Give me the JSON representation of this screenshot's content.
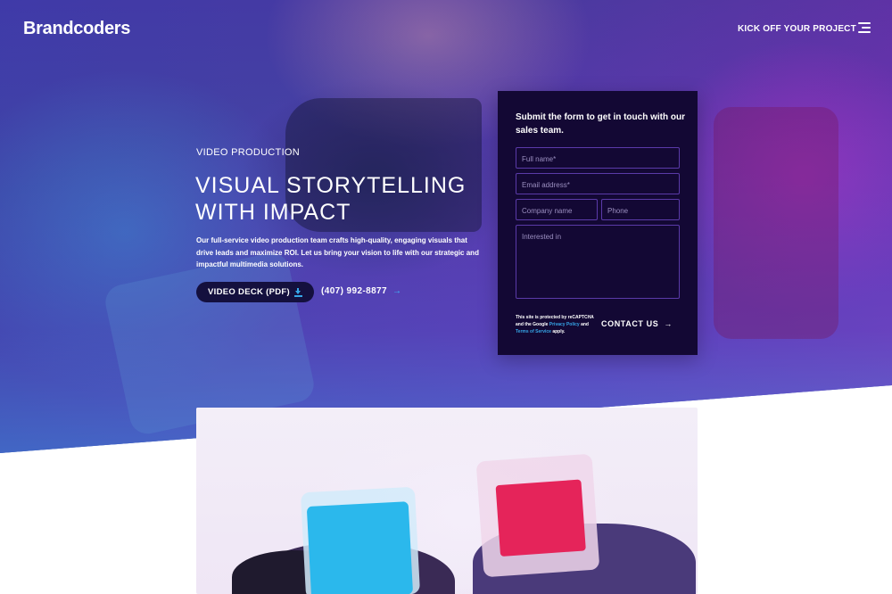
{
  "header": {
    "logo_text": "Brandcoders",
    "kickoff_label": "KICK OFF YOUR PROJECT",
    "menu_icon": "hamburger-menu-icon"
  },
  "hero": {
    "eyebrow": "VIDEO PRODUCTION",
    "headline_line1": "VISUAL STORYTELLING",
    "headline_line2": "WITH IMPACT",
    "description": "Our full-service video production team crafts high-quality, engaging visuals that drive leads and maximize ROI. Let us bring your vision to life with our strategic and impactful multimedia solutions.",
    "deck_button_label": "VIDEO DECK (PDF)",
    "deck_icon": "download-icon",
    "phone": "(407) 992-8877",
    "phone_arrow": "→"
  },
  "form": {
    "title": "Submit the form to get in touch with our sales team.",
    "full_name_placeholder": "Full name*",
    "email_placeholder": "Email address*",
    "company_placeholder": "Company name",
    "phone_placeholder": "Phone",
    "interest_placeholder": "Interested in",
    "recaptcha_text_1": "This site is protected by reCAPTCHA and the Google ",
    "privacy_link": "Privacy Policy",
    "recaptcha_and": " and ",
    "terms_link": "Terms of Service",
    "recaptcha_text_2": " apply.",
    "contact_label": "CONTACT US",
    "contact_arrow": "→"
  },
  "colors": {
    "form_bg": "#130834",
    "deck_button_bg": "#14103e",
    "accent_blue": "#36a6e8",
    "field_border": "#5a3aa8"
  }
}
